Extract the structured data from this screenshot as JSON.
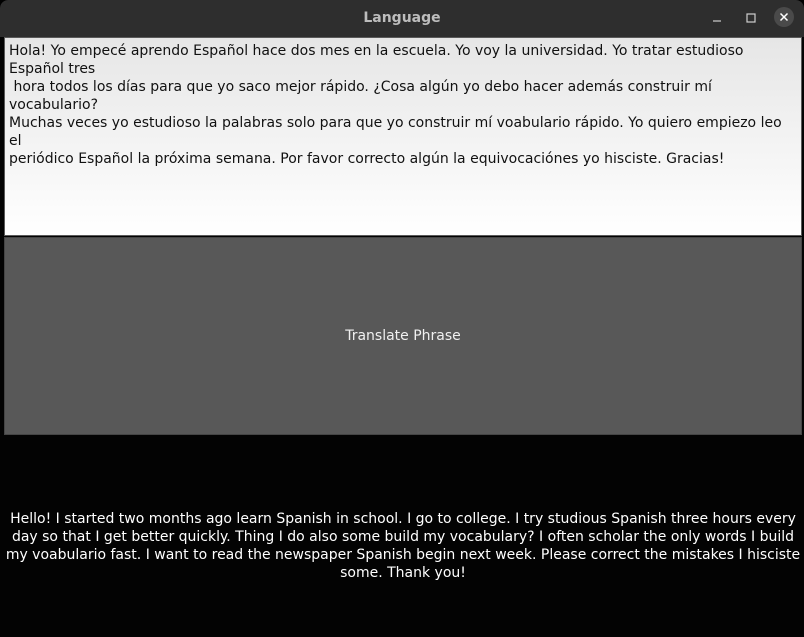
{
  "window": {
    "title": "Language",
    "minimize_glyph": "–",
    "maximize_glyph": "□"
  },
  "input": {
    "text": "Hola! Yo empecé aprendo Español hace dos mes en la escuela. Yo voy la universidad. Yo tratar estudioso Español tres\n hora todos los días para que yo saco mejor rápido. ¿Cosa algún yo debo hacer además construir mí vocabulario?\nMuchas veces yo estudioso la palabras solo para que yo construir mí voabulario rápido. Yo quiero empiezo leo el\nperiódico Español la próxima semana. Por favor correcto algún la equivocaciónes yo hisciste. Gracias!"
  },
  "translate_button": {
    "label": "Translate Phrase"
  },
  "output": {
    "text": "Hello! I started two months ago learn Spanish in school. I go to college. I try studious Spanish three hours every day so that I get better quickly. Thing I do also some build my vocabulary? I often scholar the only words I build my voabulario fast. I want to read the newspaper Spanish begin next week. Please correct the mistakes I hisciste some. Thank you!"
  },
  "colors": {
    "titlebar": "#2e2e2e",
    "background": "#030303",
    "button": "#585858"
  }
}
